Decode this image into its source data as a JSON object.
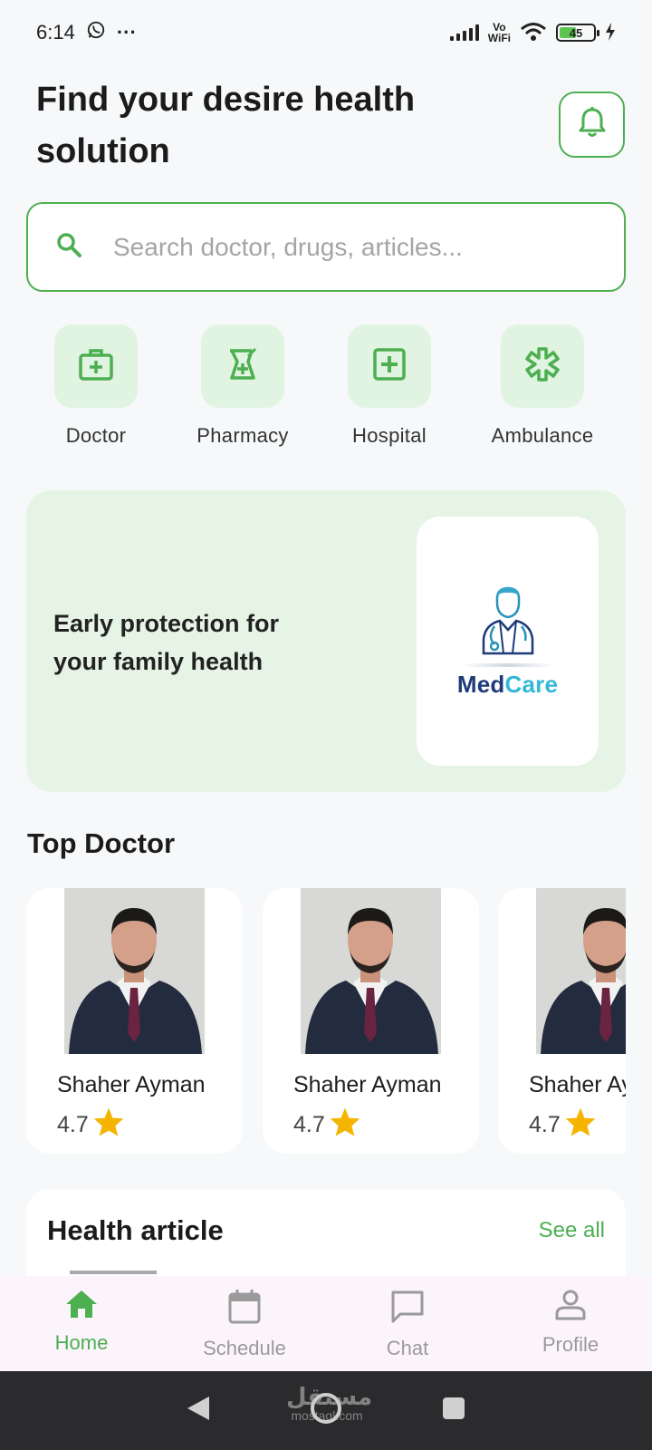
{
  "status_bar": {
    "time": "6:14",
    "more": "···",
    "network_top": "Vo",
    "network_bottom": "WiFi",
    "battery": "45"
  },
  "header": {
    "title": "Find your desire health solution"
  },
  "search": {
    "placeholder": "Search doctor, drugs, articles..."
  },
  "categories": [
    {
      "label": "Doctor",
      "icon": "medical-bag-icon"
    },
    {
      "label": "Pharmacy",
      "icon": "pharmacy-icon"
    },
    {
      "label": "Hospital",
      "icon": "hospital-icon"
    },
    {
      "label": "Ambulance",
      "icon": "asterisk-icon"
    }
  ],
  "banner": {
    "text": "Early protection for your family health",
    "logo_part1": "Med",
    "logo_part2": "Care"
  },
  "top_doctor": {
    "title": "Top Doctor",
    "doctors": [
      {
        "name": "Shaher Ayman",
        "rating": "4.7"
      },
      {
        "name": "Shaher Ayman",
        "rating": "4.7"
      },
      {
        "name": "Shaher Ayman",
        "rating": "4.7"
      }
    ]
  },
  "articles": {
    "title": "Health article",
    "see_all": "See all"
  },
  "nav": [
    {
      "label": "Home",
      "icon": "home-icon",
      "active": true
    },
    {
      "label": "Schedule",
      "icon": "calendar-icon",
      "active": false
    },
    {
      "label": "Chat",
      "icon": "chat-icon",
      "active": false
    },
    {
      "label": "Profile",
      "icon": "profile-icon",
      "active": false
    }
  ],
  "watermark": {
    "arabic": "مستقل",
    "latin": "mostaql.com"
  },
  "colors": {
    "accent": "#4caf50",
    "tile_bg": "#e1f3e1",
    "banner_bg": "#e6f4e6",
    "star": "#f5b400"
  }
}
